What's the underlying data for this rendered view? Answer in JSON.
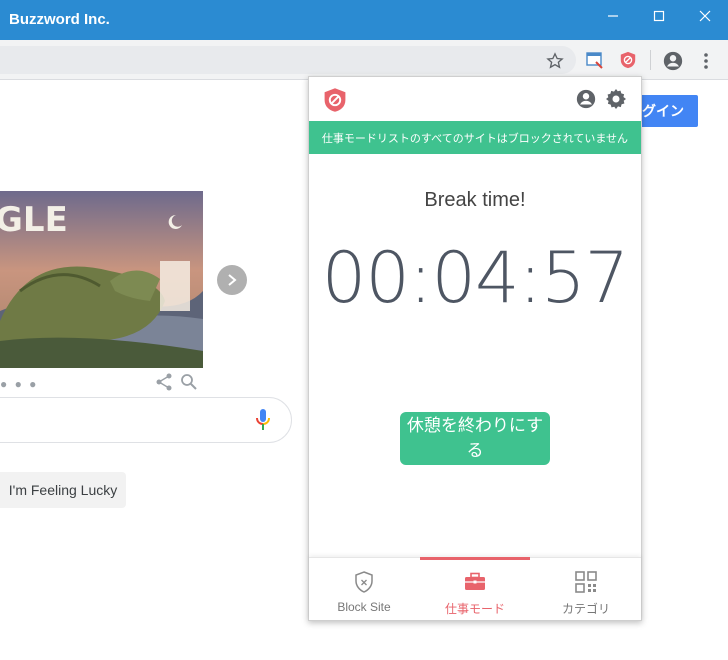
{
  "window": {
    "title": "Buzzword Inc.",
    "controls": [
      "minimize",
      "maximize",
      "close"
    ]
  },
  "colors": {
    "titlebar": "#2b8bd2",
    "accent_green": "#3fc28f",
    "accent_red": "#e8636b",
    "google_blue": "#4285f4"
  },
  "google_page": {
    "login_label": "ログイン",
    "lucky_label": "I'm Feeling Lucky",
    "doodle_text": "GLE"
  },
  "popup": {
    "banner": "仕事モードリストのすべてのサイトはブロックされていません",
    "break_label": "Break time!",
    "timer": "00:04:57",
    "end_button": "休憩を終わりにする",
    "nav": [
      {
        "label": "Block Site",
        "icon": "shield-icon"
      },
      {
        "label": "仕事モード",
        "icon": "briefcase-icon"
      },
      {
        "label": "カテゴリ",
        "icon": "grid-icon"
      }
    ]
  }
}
